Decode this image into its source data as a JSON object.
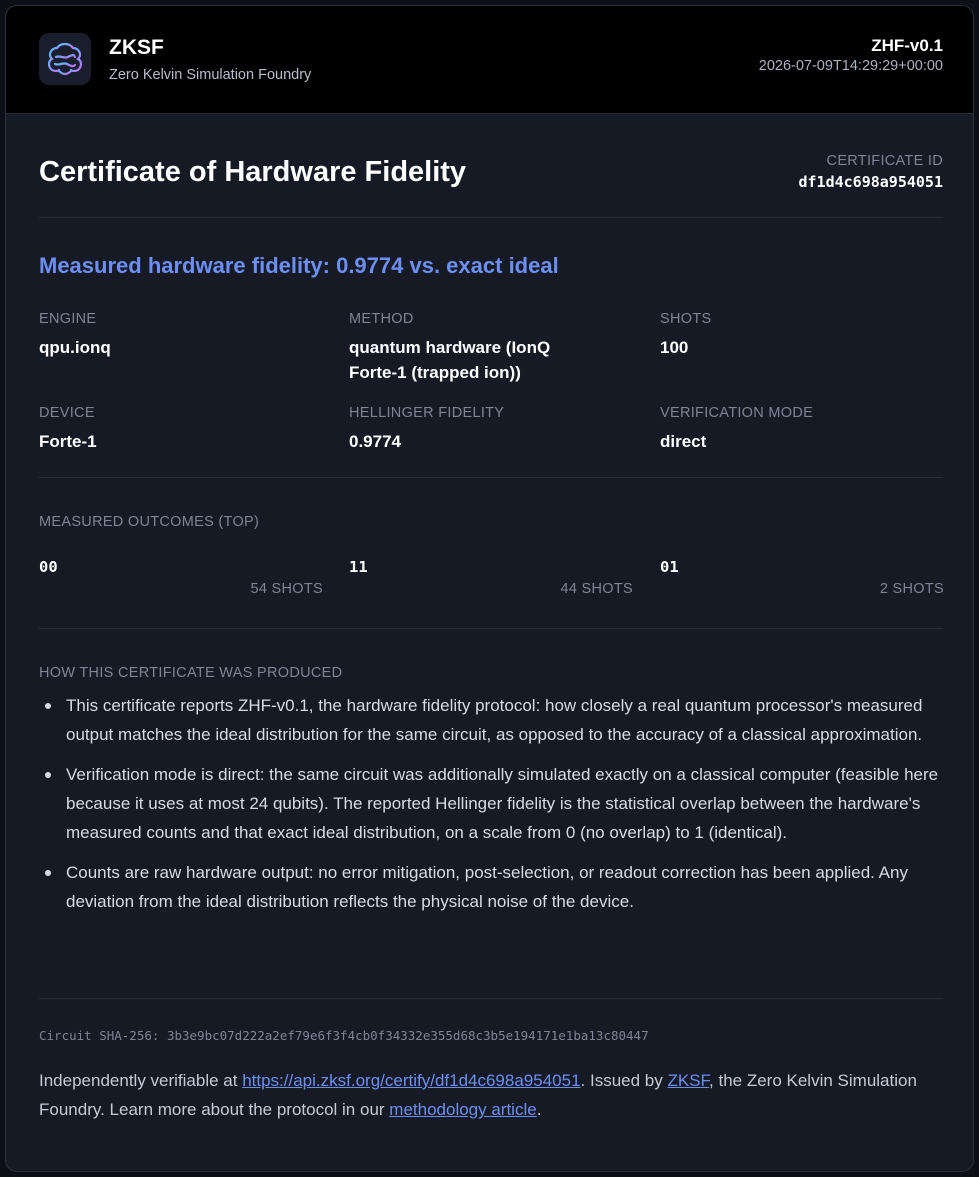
{
  "header": {
    "brand_name": "ZKSF",
    "brand_subtitle": "Zero Kelvin Simulation Foundry",
    "protocol": "ZHF-v0.1",
    "timestamp": "2026-07-09T14:29:29+00:00",
    "logo_icon": "brain-circuit-icon"
  },
  "certificate": {
    "title": "Certificate of Hardware Fidelity",
    "id_label": "CERTIFICATE ID",
    "id_value": "df1d4c698a954051",
    "headline": "Measured hardware fidelity: 0.9774 vs. exact ideal"
  },
  "fields": [
    {
      "label": "ENGINE",
      "value": "qpu.ionq"
    },
    {
      "label": "METHOD",
      "value": "quantum hardware (IonQ Forte-1 (trapped ion))"
    },
    {
      "label": "SHOTS",
      "value": "100"
    },
    {
      "label": "DEVICE",
      "value": "Forte-1"
    },
    {
      "label": "HELLINGER FIDELITY",
      "value": "0.9774"
    },
    {
      "label": "VERIFICATION MODE",
      "value": "direct"
    }
  ],
  "outcomes": {
    "label": "MEASURED OUTCOMES (TOP)",
    "items": [
      {
        "state": "00",
        "shots": "54 SHOTS"
      },
      {
        "state": "11",
        "shots": "44 SHOTS"
      },
      {
        "state": "01",
        "shots": "2 SHOTS"
      }
    ]
  },
  "how": {
    "label": "HOW THIS CERTIFICATE WAS PRODUCED",
    "items": [
      "This certificate reports ZHF-v0.1, the hardware fidelity protocol: how closely a real quantum processor's measured output matches the ideal distribution for the same circuit, as opposed to the accuracy of a classical approximation.",
      "Verification mode is direct: the same circuit was additionally simulated exactly on a classical computer (feasible here because it uses at most 24 qubits). The reported Hellinger fidelity is the statistical overlap between the hardware's measured counts and that exact ideal distribution, on a scale from 0 (no overlap) to 1 (identical).",
      "Counts are raw hardware output: no error mitigation, post-selection, or readout correction has been applied. Any deviation from the ideal distribution reflects the physical noise of the device."
    ]
  },
  "sha": {
    "label": "Circuit SHA-256:",
    "value": "3b3e9bc07d222a2ef79e6f3f4cb0f34332e355d68c3b5e194171e1ba13c80447"
  },
  "footer": {
    "text1": "Independently verifiable at ",
    "verify_link": "https://api.zksf.org/certify/df1d4c698a954051",
    "text2": ". Issued by ",
    "issuer_link": "ZKSF",
    "text3": ", the Zero Kelvin Simulation Foundry. Learn more about the protocol in our ",
    "methodology_link": "methodology article",
    "text4": "."
  }
}
